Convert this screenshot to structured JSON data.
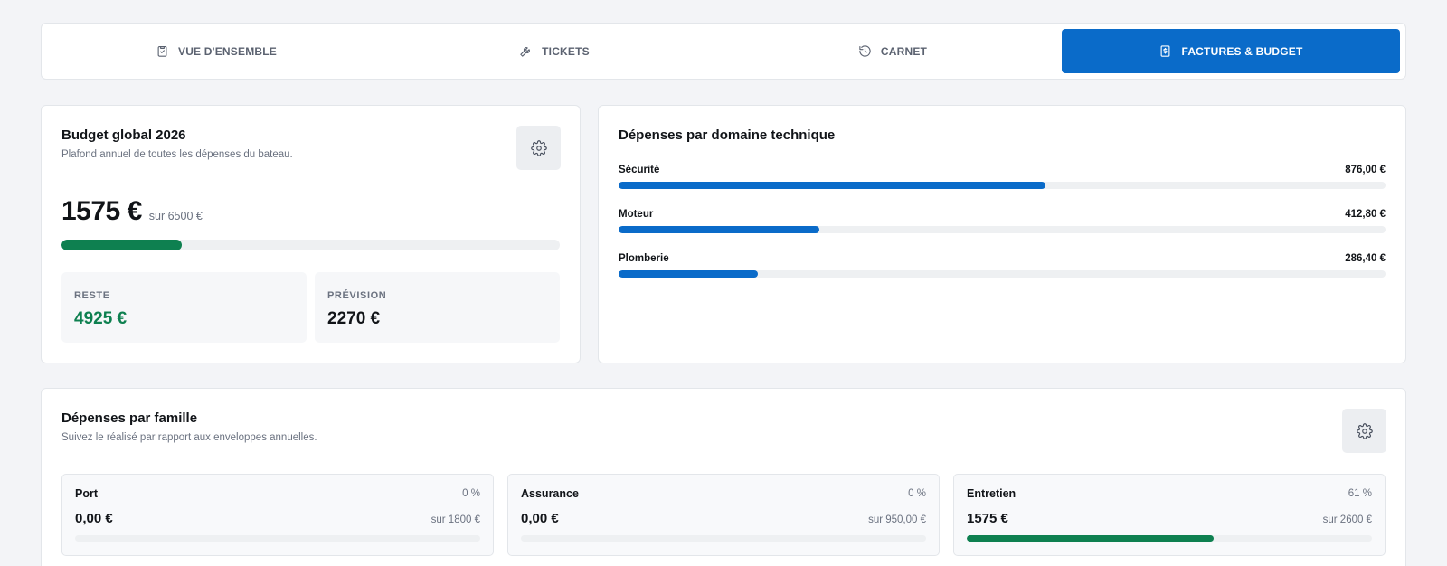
{
  "tabs": [
    {
      "label": "VUE D'ENSEMBLE",
      "icon": "clipboard-check-icon",
      "active": false
    },
    {
      "label": "TICKETS",
      "icon": "wrench-icon",
      "active": false
    },
    {
      "label": "CARNET",
      "icon": "history-icon",
      "active": false
    },
    {
      "label": "FACTURES & BUDGET",
      "icon": "invoice-dollar-icon",
      "active": true
    }
  ],
  "budget": {
    "title": "Budget global 2026",
    "subtitle": "Plafond annuel de toutes les dépenses du bateau.",
    "amount": "1575 €",
    "of": "sur 6500 €",
    "progress": 0.242,
    "remaining_label": "RESTE",
    "remaining_value": "4925 €",
    "forecast_label": "PRÉVISION",
    "forecast_value": "2270 €"
  },
  "domains": {
    "title": "Dépenses par domaine technique",
    "items": [
      {
        "label": "Sécurité",
        "value": "876,00 €",
        "progress": 0.557
      },
      {
        "label": "Moteur",
        "value": "412,80 €",
        "progress": 0.262
      },
      {
        "label": "Plomberie",
        "value": "286,40 €",
        "progress": 0.182
      }
    ]
  },
  "families": {
    "title": "Dépenses par famille",
    "subtitle": "Suivez le réalisé par rapport aux enveloppes annuelles.",
    "items": [
      {
        "name": "Port",
        "pct": "0 %",
        "amount": "0,00 €",
        "of": "sur 1800 €",
        "progress": 0
      },
      {
        "name": "Assurance",
        "pct": "0 %",
        "amount": "0,00 €",
        "of": "sur 950,00 €",
        "progress": 0
      },
      {
        "name": "Entretien",
        "pct": "61 %",
        "amount": "1575 €",
        "of": "sur 2600 €",
        "progress": 0.61
      }
    ]
  },
  "colors": {
    "accent": "#0a6bc9",
    "success": "#0e8050",
    "track": "#eef0f2"
  }
}
